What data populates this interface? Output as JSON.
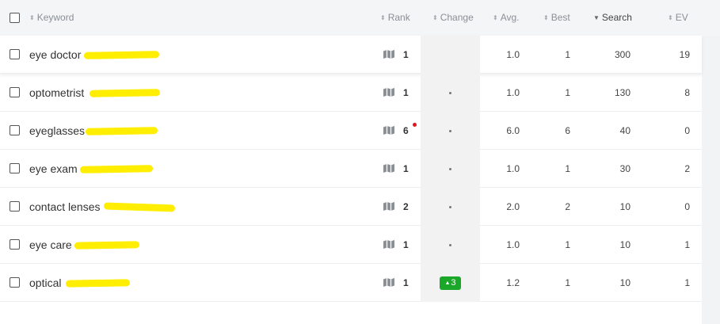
{
  "header": {
    "keyword": "Keyword",
    "rank": "Rank",
    "change": "Change",
    "avg": "Avg.",
    "best": "Best",
    "search": "Search",
    "ev": "EV",
    "sort_icon": "sort-both-icon",
    "active_sort_icon": "sort-desc-icon"
  },
  "colors": {
    "header_bg": "#f3f5f7",
    "change_col_bg": "#f2f2f2",
    "badge_up": "#1aa72a",
    "highlight": "#ffee00",
    "alert_dot": "#e0141e"
  },
  "rows": [
    {
      "keyword": "eye doctor",
      "rank": "1",
      "change": "",
      "avg": "1.0",
      "best": "1",
      "search": "300",
      "ev": "19"
    },
    {
      "keyword": "optometrist",
      "rank": "1",
      "change": "",
      "avg": "1.0",
      "best": "1",
      "search": "130",
      "ev": "8"
    },
    {
      "keyword": "eyeglasses",
      "rank": "6",
      "change": "",
      "avg": "6.0",
      "best": "6",
      "search": "40",
      "ev": "0"
    },
    {
      "keyword": "eye exam",
      "rank": "1",
      "change": "",
      "avg": "1.0",
      "best": "1",
      "search": "30",
      "ev": "2"
    },
    {
      "keyword": "contact lenses",
      "rank": "2",
      "change": "",
      "avg": "2.0",
      "best": "2",
      "search": "10",
      "ev": "0"
    },
    {
      "keyword": "eye care",
      "rank": "1",
      "change": "",
      "avg": "1.0",
      "best": "1",
      "search": "10",
      "ev": "1"
    },
    {
      "keyword": "optical",
      "rank": "1",
      "change": "3",
      "avg": "1.2",
      "best": "1",
      "search": "10",
      "ev": "1"
    }
  ]
}
